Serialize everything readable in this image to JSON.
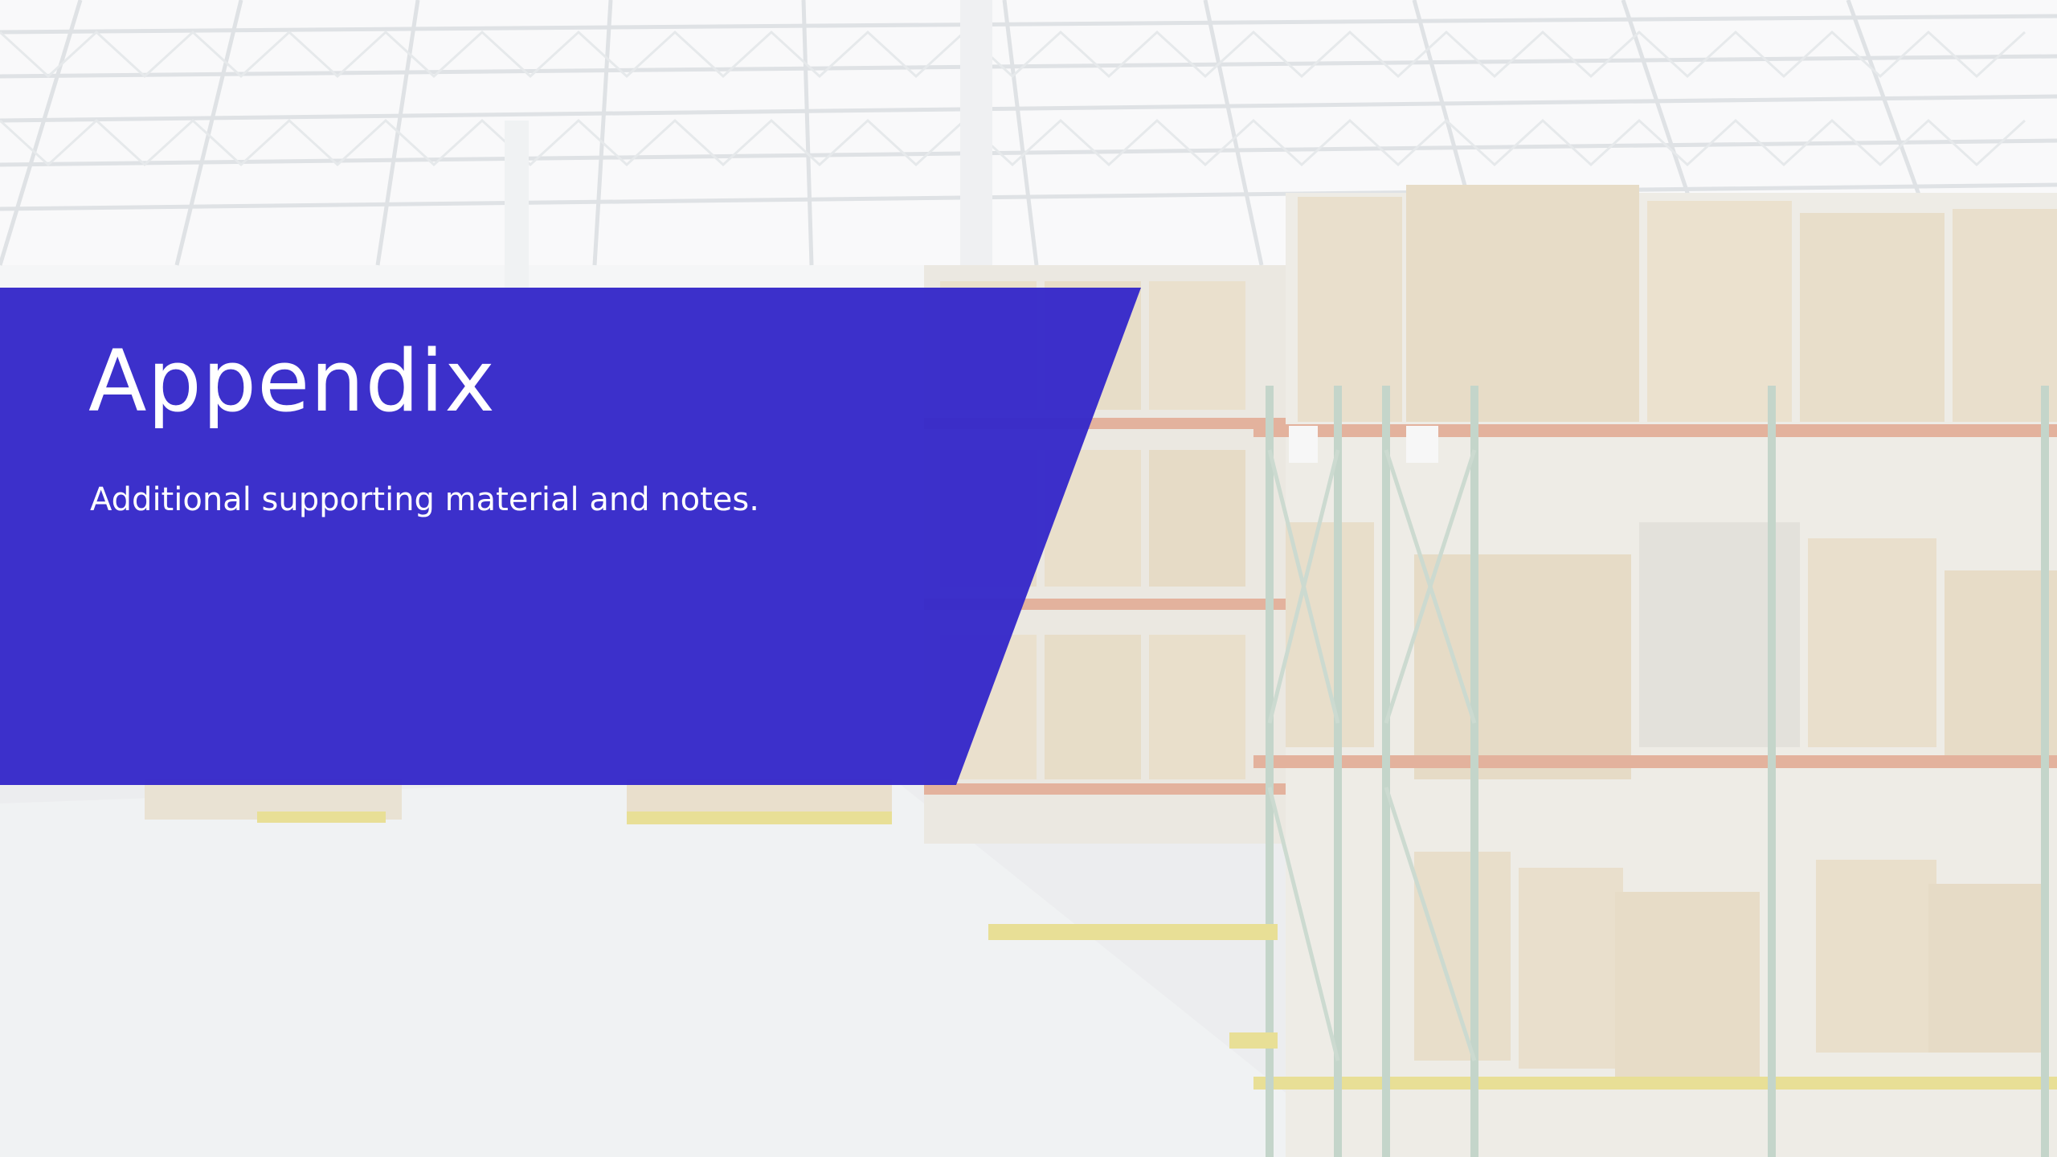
{
  "slide": {
    "title": "Appendix",
    "subtitle": "Additional supporting material and notes."
  },
  "background": {
    "subject": "warehouse-shelving-photo"
  },
  "colors": {
    "banner": "#3629c9",
    "text": "#ffffff",
    "rack_orange": "#c9653d",
    "rack_green": "#8fae9a",
    "box": "#d8c6a4",
    "pallet_yellow": "#d8c84a"
  }
}
